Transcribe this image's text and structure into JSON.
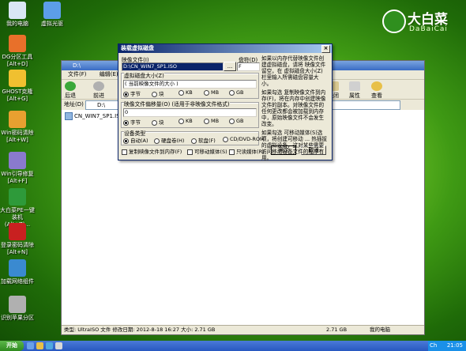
{
  "desktop": {
    "icons": [
      {
        "label": "我的电脑",
        "color": "#d9e6f5"
      },
      {
        "label": "虚拟光驱",
        "color": "#5c9ee8"
      },
      {
        "label": "DG分区工具 [Alt+D]",
        "color": "#e8702a"
      },
      {
        "label": "GHOST克隆 [Alt+G]",
        "color": "#f0c030"
      },
      {
        "label": "Win密码清除 [Alt+W]",
        "color": "#e8a030"
      },
      {
        "label": "Win引导修复 [Alt+F]",
        "color": "#8a7acd"
      },
      {
        "label": "大白菜PE一键装机(Alt+Z)...",
        "color": "#2e9a3a"
      },
      {
        "label": "登录密码清除 [Alt+N]",
        "color": "#c82020"
      },
      {
        "label": "加载网络组件",
        "color": "#3a8ad0"
      },
      {
        "label": "识别苹果分区",
        "color": "#b0b0b0"
      }
    ],
    "logo": {
      "name": "大白菜",
      "pinyin": "DaBaiCai"
    }
  },
  "explorer": {
    "title": "D:\\",
    "menu": [
      "文件(F)",
      "编辑(E)"
    ],
    "toolbar": {
      "back": "后退",
      "forward": "前进",
      "close": "关闭",
      "properties": "属性",
      "view": "查看"
    },
    "address_label": "地址(D)",
    "address_value": "D:\\",
    "files": [
      {
        "name": "CN_WIN7_SP1.ISO"
      }
    ],
    "status": {
      "info": "类型: UltraISO 文件 修改日期: 2012-8-18 16:27 大小: 2.71 GB",
      "size": "2.71 GB",
      "location": "我的电脑"
    }
  },
  "dialog": {
    "title": "装载虚拟磁盘",
    "image_file_label": "映像文件(I)",
    "image_file_value": "D:\\CN_WIN7_SP1.ISO",
    "browse_label": "...",
    "drive_label": "盘符(D)",
    "drive_value": "F",
    "disk_size_label": "虚拟磁盘大小(Z)",
    "disk_size_value": "( 当前映像文件的大小 )",
    "unit_options": [
      "字节",
      "块",
      "KB",
      "MB",
      "GB"
    ],
    "offset_label": "映像文件偏移量(O) (适用于非映像文件格式)",
    "offset_value": "0",
    "device_type_label": "设备类型",
    "device_options": [
      "自动(A)",
      "硬盘卷(H)",
      "软盘(F)",
      "CD/DVD-ROM"
    ],
    "check_memory": "复制映像文件到内存(F)",
    "check_removable": "可移动媒体(S)",
    "check_readonly": "只读媒体(R)",
    "ok": "确定",
    "cancel": "取消",
    "help1": "如果以内存代替映像文件创建虚拟磁盘，请将 映像文件 留空，在 虚拟磁盘大小(Z)栏里输入所需磁盘容量大小。",
    "help2": "如果勾选 复制映像文件到内存(F)，将在内存中创建映像文件的副本。对映像文件的任何更改都会被加载到内存中，原始映像文件不会发生改变。",
    "help3": "如果勾选 可移动媒体(S)选项，将创建可移动 ... 热插拔的虚拟设备，这对某些需要访问移动设备文件的程序有用。"
  },
  "taskbar": {
    "start": "开始",
    "clock": "21:05",
    "tray_ime": "Ch"
  }
}
